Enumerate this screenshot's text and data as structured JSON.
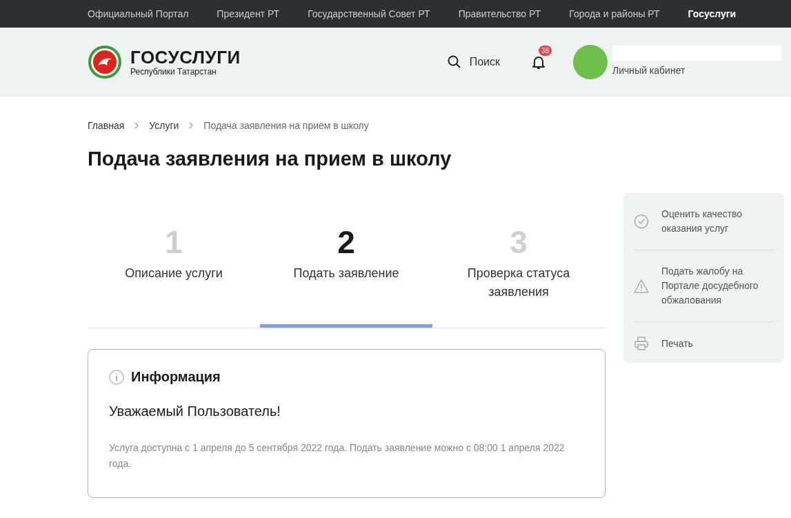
{
  "top_nav": [
    {
      "label": "Официальный Портал",
      "selected": false
    },
    {
      "label": "Президент РТ",
      "selected": false
    },
    {
      "label": "Государственный Совет РТ",
      "selected": false
    },
    {
      "label": "Правительство РТ",
      "selected": false
    },
    {
      "label": "Города и районы РТ",
      "selected": false
    },
    {
      "label": "Госуслуги",
      "selected": true
    }
  ],
  "header": {
    "logo_title": "ГОСУСЛУГИ",
    "logo_subtitle": "Республики Татарстан",
    "search_label": "Поиск",
    "notification_count": "38",
    "account_label": "Личный кабинет"
  },
  "breadcrumbs": [
    "Главная",
    "Услуги",
    "Подача заявления на прием в школу"
  ],
  "page_title": "Подача заявления на прием в школу",
  "steps": [
    {
      "number": "1",
      "label": "Описание услуги",
      "selected": false
    },
    {
      "number": "2",
      "label": "Подать заявление",
      "selected": true
    },
    {
      "number": "3",
      "label": "Проверка статуса заявления",
      "selected": false
    }
  ],
  "info": {
    "title": "Информация",
    "greeting": "Уважаемый Пользователь!",
    "text": "Услуга доступна с 1 апреля до 5 сентября 2022 года. Подать заявление можно с 08:00 1 апреля 2022 года."
  },
  "sidebar": [
    {
      "kind": "rate",
      "label": "Оценить качество оказания услуг"
    },
    {
      "kind": "complaint",
      "label": "Подать жалобу на Портале досудебного обжалования"
    },
    {
      "kind": "print",
      "label": "Печать"
    }
  ]
}
